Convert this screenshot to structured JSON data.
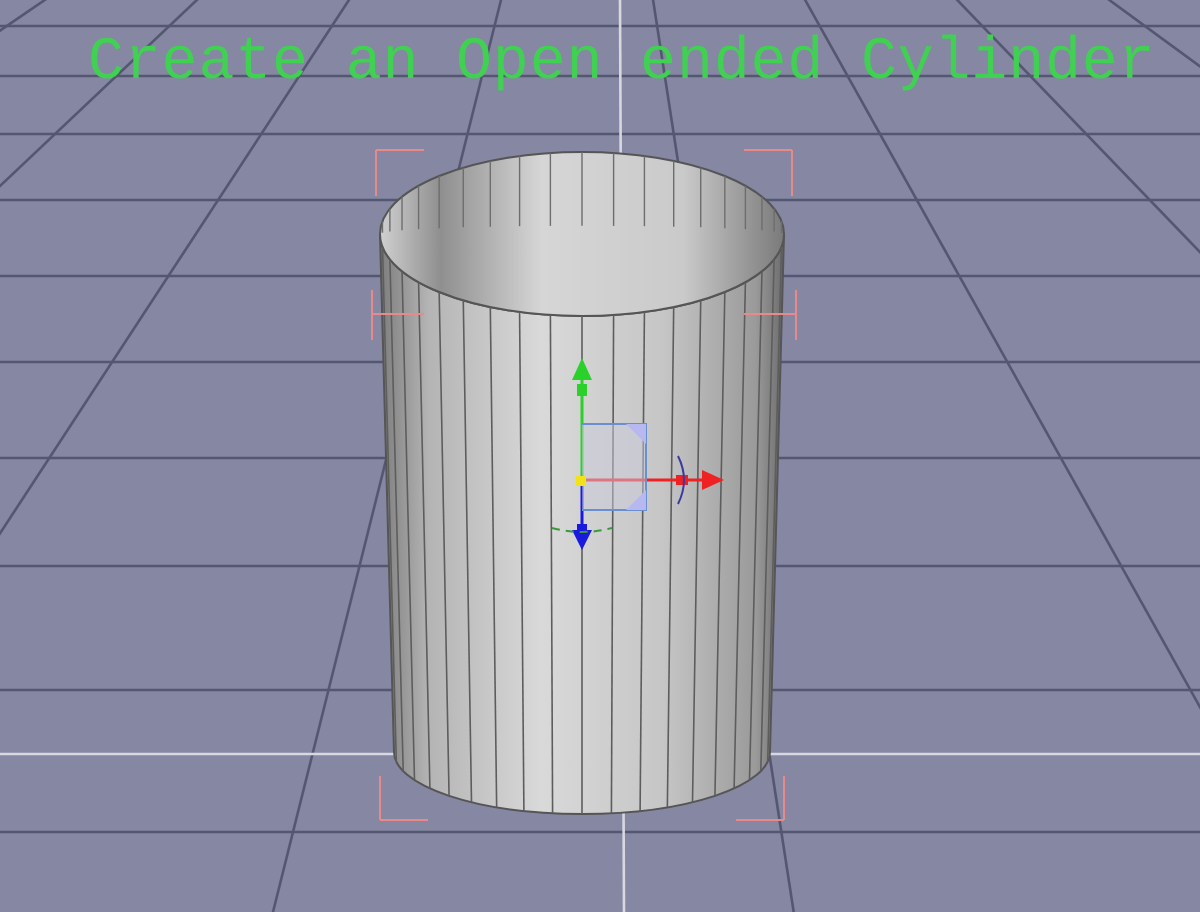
{
  "viewport": {
    "caption": "Create an Open ended Cylinder"
  }
}
